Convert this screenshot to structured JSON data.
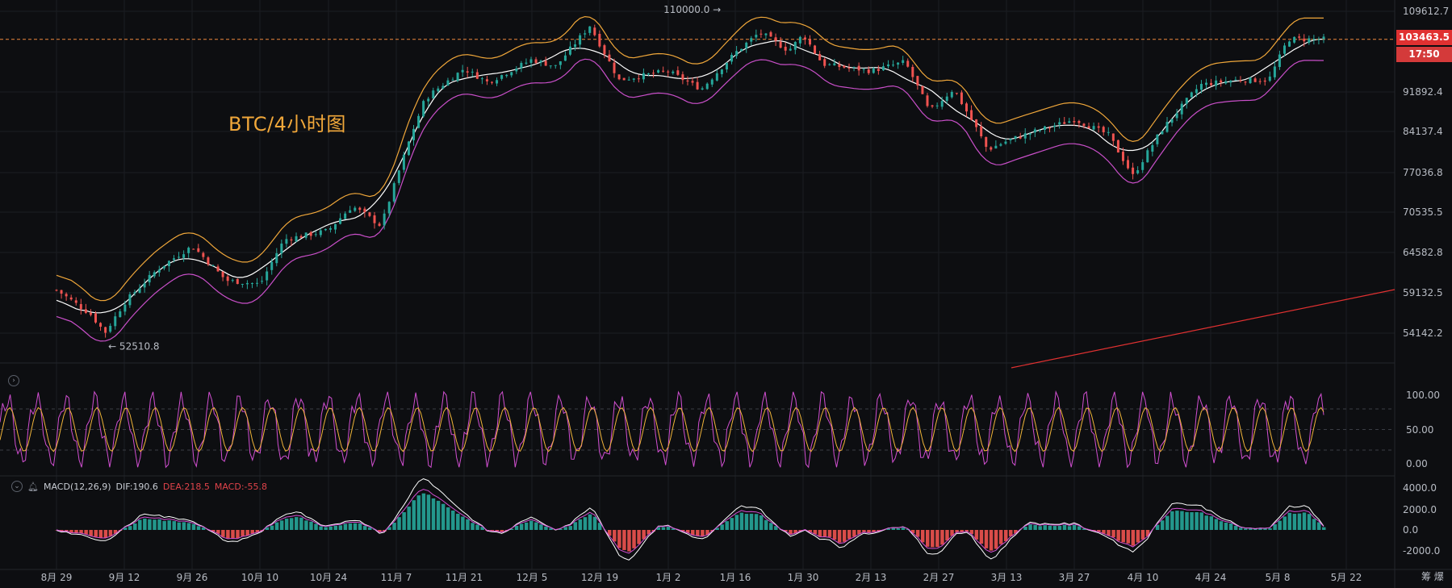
{
  "overlay_title": "BTC/4小时图",
  "price_axis": {
    "labels": [
      "109612.7",
      "91892.4",
      "84137.4",
      "77036.8",
      "70535.5",
      "64582.8",
      "59132.5",
      "54142.2"
    ],
    "current_price": "103463.5",
    "countdown": "17:50"
  },
  "annotations": {
    "high": "110000.0",
    "low": "52510.8"
  },
  "stoch_axis": [
    "100.00",
    "50.00",
    "0.00"
  ],
  "macd": {
    "label": "MACD(12,26,9)",
    "dif": "DIF:190.6",
    "dea": "DEA:218.5",
    "macd": "MACD:-55.8",
    "axis": [
      "4000.0",
      "2000.0",
      "0.0",
      "-2000.0"
    ]
  },
  "x_axis": [
    "8月 29",
    "9月 12",
    "9月 26",
    "10月 10",
    "10月 24",
    "11月 7",
    "11月 21",
    "12月 5",
    "12月 19",
    "1月 2",
    "1月 16",
    "1月 30",
    "2月 13",
    "2月 27",
    "3月 13",
    "3月 27",
    "4月 10",
    "4月 24",
    "5月 8",
    "5月 22"
  ],
  "bottom_icons": "筹 爆",
  "colors": {
    "bull": "#26a69a",
    "bear": "#ef5350",
    "upper_band": "#f0a73a",
    "lower_band": "#c94fc9",
    "mid_band": "#ffffff",
    "price_line": "#f0883e",
    "trendline": "#e03131",
    "stoch_k": "#d14fd1",
    "stoch_d": "#f0b43a"
  },
  "chart_data": {
    "type": "candlestick",
    "symbol": "BTC",
    "timeframe": "4小时",
    "date_range": [
      "8月 29",
      "5月 22"
    ],
    "price_ylim": [
      52510.8,
      110000.0
    ],
    "close_path": [
      [
        "8月 29",
        59500
      ],
      [
        "9月 5",
        56500
      ],
      [
        "9月 8",
        54200
      ],
      [
        "9月 12",
        57900
      ],
      [
        "9月 19",
        62400
      ],
      [
        "9月 26",
        65500
      ],
      [
        "10月 3",
        60800
      ],
      [
        "10月 10",
        60300
      ],
      [
        "10月 15",
        66500
      ],
      [
        "10月 24",
        67800
      ],
      [
        "10月 29",
        71500
      ],
      [
        "11月 4",
        68500
      ],
      [
        "11月 7",
        75800
      ],
      [
        "11月 13",
        90500
      ],
      [
        "11月 21",
        97000
      ],
      [
        "11月 26",
        94000
      ],
      [
        "12月 5",
        99000
      ],
      [
        "12月 10",
        97500
      ],
      [
        "12月 17",
        106500
      ],
      [
        "12月 23",
        94500
      ],
      [
        "1月 2",
        96500
      ],
      [
        "1月 9",
        92500
      ],
      [
        "1月 16",
        100500
      ],
      [
        "1月 21",
        105000
      ],
      [
        "1月 27",
        101000
      ],
      [
        "1月 30",
        104500
      ],
      [
        "2月 3",
        98000
      ],
      [
        "2月 13",
        96500
      ],
      [
        "2月 20",
        98500
      ],
      [
        "2月 25",
        88000
      ],
      [
        "3月 2",
        92500
      ],
      [
        "3月 9",
        81000
      ],
      [
        "3月 13",
        82500
      ],
      [
        "3月 20",
        84500
      ],
      [
        "3月 27",
        86500
      ],
      [
        "4月 3",
        83500
      ],
      [
        "4月 8",
        76500
      ],
      [
        "4月 14",
        84500
      ],
      [
        "4月 22",
        93500
      ],
      [
        "4月 29",
        94500
      ],
      [
        "5月 6",
        94500
      ],
      [
        "5月 10",
        103500
      ],
      [
        "5月 15",
        103463.5
      ]
    ],
    "current_price": 103463.5,
    "high": 110000.0,
    "low": 52510.8,
    "overlays": [
      "upper band",
      "middle band",
      "lower band"
    ],
    "stochastic_ylim": [
      0,
      100
    ],
    "stochastic_levels": [
      80,
      50,
      20
    ],
    "macd_params": [
      12,
      26,
      9
    ],
    "macd_ylim": [
      -2500,
      4000
    ],
    "dif": 190.6,
    "dea": 218.5,
    "macd_value": -55.8
  }
}
